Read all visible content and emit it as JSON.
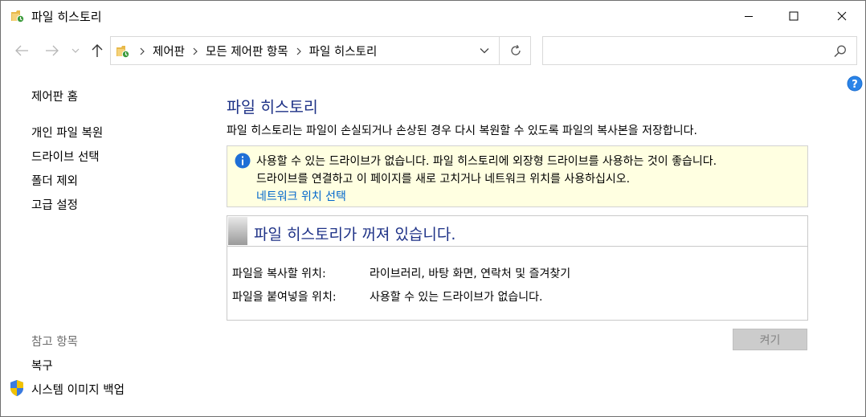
{
  "window": {
    "title": "파일 히스토리",
    "icon": "file-history-folder-icon"
  },
  "window_controls": {
    "minimize_icon": "minimize-icon",
    "maximize_icon": "maximize-icon",
    "close_icon": "close-icon"
  },
  "navigation": {
    "back_icon": "arrow-left-icon",
    "forward_icon": "arrow-right-icon",
    "recent_icon": "chevron-down-icon",
    "up_icon": "arrow-up-icon"
  },
  "address_bar": {
    "breadcrumbs": [
      "제어판",
      "모든 제어판 항목",
      "파일 히스토리"
    ],
    "refresh_icon": "refresh-icon"
  },
  "search": {
    "value": "",
    "placeholder": ""
  },
  "sidebar": {
    "items": [
      {
        "label": "제어판 홈"
      },
      {
        "label": "개인 파일 복원"
      },
      {
        "label": "드라이브 선택"
      },
      {
        "label": "폴더 제외"
      },
      {
        "label": "고급 설정"
      }
    ],
    "see_also_heading": "참고 항목",
    "see_also_items": [
      {
        "label": "복구"
      },
      {
        "label": "시스템 이미지 백업",
        "icon": "uac-shield-icon"
      }
    ]
  },
  "main": {
    "title": "파일 히스토리",
    "description": "파일 히스토리는 파일이 손실되거나 손상된 경우 다시 복원할 수 있도록 파일의 복사본을 저장합니다.",
    "info": {
      "icon": "info-icon",
      "line1": "사용할 수 있는 드라이브가 없습니다. 파일 히스토리에 외장형 드라이브를 사용하는 것이 좋습니다.",
      "line2": "드라이브를 연결하고 이 페이지를 새로 고치거나 네트워크 위치를 사용하십시오.",
      "link": "네트워크 위치 선택"
    },
    "status": {
      "title": "파일 히스토리가 꺼져 있습니다.",
      "copy_from_label": "파일을 복사할 위치:",
      "copy_from_value": "라이브러리, 바탕 화면, 연락처 및 즐겨찾기",
      "copy_to_label": "파일을 붙여넣을 위치:",
      "copy_to_value": "사용할 수 있는 드라이브가 없습니다."
    },
    "turn_on_button": "켜기"
  },
  "colors": {
    "heading_blue": "#1e3287",
    "link_blue": "#0066cc",
    "info_background": "#ffffe1",
    "disabled_button": "#cccccc"
  }
}
